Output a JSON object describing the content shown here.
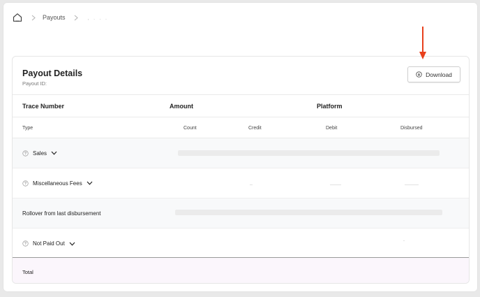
{
  "breadcrumb": {
    "home_icon": "home-icon",
    "separator_icon": "chevron-right-icon",
    "items": [
      "Payouts"
    ],
    "current": ", . . ."
  },
  "annotation": {
    "arrow_color": "#e8401c"
  },
  "card": {
    "title": "Payout Details",
    "subtitle": "Payout ID:",
    "download_label": "Download",
    "download_icon": "download-circle-icon"
  },
  "meta": [
    "Trace Number",
    "Amount",
    "Platform"
  ],
  "columns": [
    "Type",
    "Count",
    "Credit",
    "Debit",
    "Disbursed"
  ],
  "rows": [
    {
      "label": "Sales",
      "has_help": true,
      "expandable": true
    },
    {
      "label": "Miscellaneous Fees",
      "has_help": true,
      "expandable": true
    },
    {
      "label": "Rollover from last disbursement",
      "has_help": false,
      "expandable": false
    },
    {
      "label": "Not Paid Out",
      "has_help": true,
      "expandable": true
    }
  ],
  "total_label": "Total",
  "colors": {
    "total_bg": "#fbf6fc",
    "skeleton": "#ebebeb",
    "row_alt": "#f8f9fa"
  }
}
